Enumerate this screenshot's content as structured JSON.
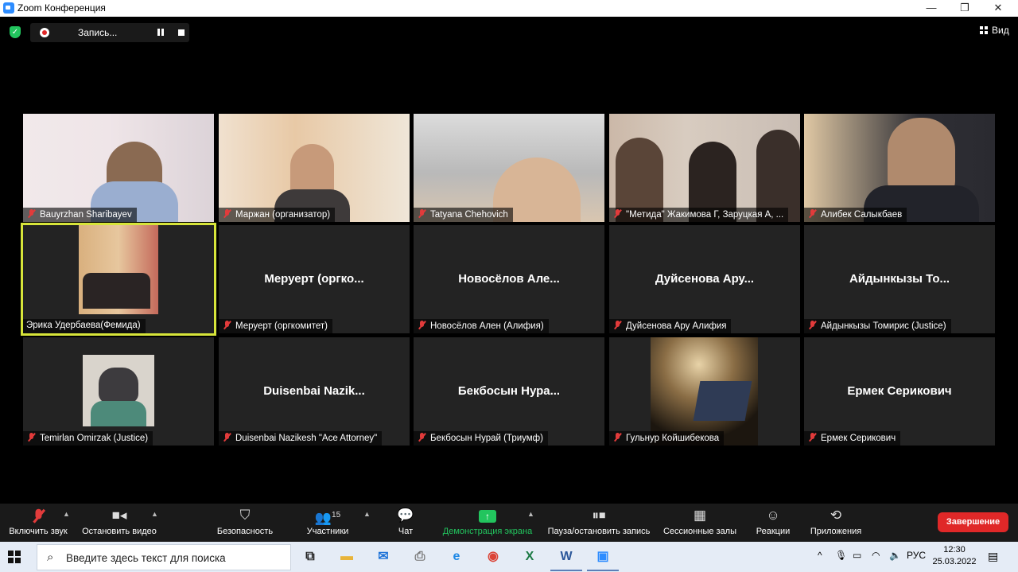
{
  "window": {
    "title": "Zoom Конференция",
    "minimize": "—",
    "restore": "❐",
    "close": "✕"
  },
  "recording": {
    "label": "Запись..."
  },
  "view": {
    "label": "Вид"
  },
  "participants": [
    {
      "name": "Bauyrzhan Sharibayev",
      "video": true
    },
    {
      "name": "Маржан (организатор)",
      "video": true
    },
    {
      "name": "Tatyana Chehovich",
      "video": true
    },
    {
      "name": "\"Метида\" Жакимова Г, Заруцкая А, ...",
      "video": true
    },
    {
      "name": "Алибек Салыкбаев",
      "video": true
    },
    {
      "name": "Эрика Удербаева(Фемида)",
      "video": true,
      "active_speaker": true
    },
    {
      "name": "Меруерт (оргкомитет)",
      "display": "Меруерт  (оргко...",
      "video": false
    },
    {
      "name": "Новосёлов Ален (Алифия)",
      "display": "Новосёлов  Але...",
      "video": false
    },
    {
      "name": "Дуйсенова Ару Алифия",
      "display": "Дуйсенова  Ару...",
      "video": false
    },
    {
      "name": "Айдынкызы Томирис (Justice)",
      "display": "Айдынкызы  То...",
      "video": false
    },
    {
      "name": "Temirlan Omirzak (Justice)",
      "video": true
    },
    {
      "name": "Duisenbai Nazikesh \"Ace Attorney\"",
      "display": "Duisenbai  Nazik...",
      "video": false
    },
    {
      "name": "Бекбосын Нурай (Триумф)",
      "display": "Бекбосын  Нура...",
      "video": false
    },
    {
      "name": "Гульнур Койшибекова",
      "video": true
    },
    {
      "name": "Ермек Серикович",
      "display": "Ермек  Серикович",
      "video": false
    }
  ],
  "toolbar": {
    "unmute": "Включить звук",
    "stop_video": "Остановить видео",
    "security": "Безопасность",
    "participants": "Участники",
    "participants_count": "15",
    "chat": "Чат",
    "share": "Демонстрация экрана",
    "pause_recording": "Пауза/остановить запись",
    "breakout": "Сессионные залы",
    "reactions": "Реакции",
    "apps": "Приложения",
    "end": "Завершение",
    "share_color": "#22c55e",
    "end_color": "#e02828"
  },
  "taskbar": {
    "search_placeholder": "Введите здесь текст для поиска",
    "language": "РУС",
    "time": "12:30",
    "date": "25.03.2022"
  }
}
